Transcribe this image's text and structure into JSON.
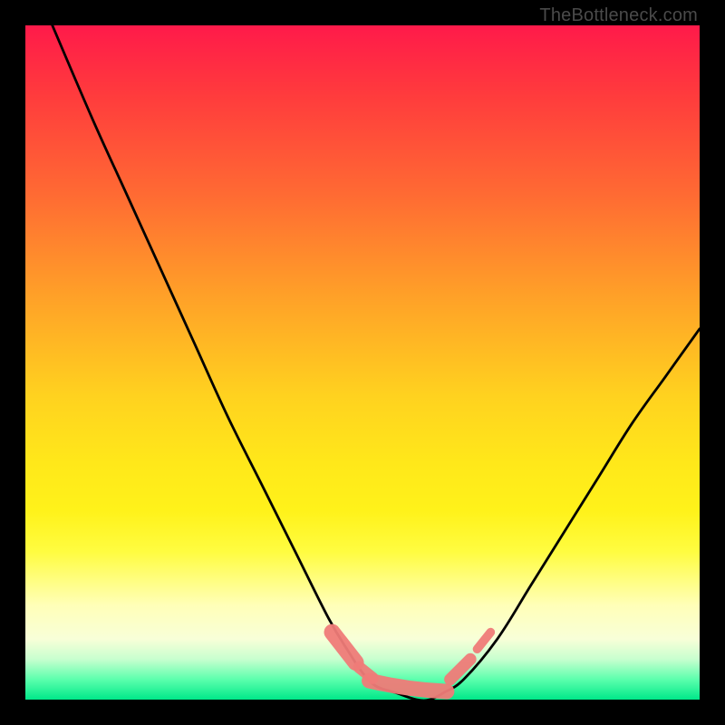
{
  "watermark": "TheBottleneck.com",
  "chart_data": {
    "type": "line",
    "title": "",
    "xlabel": "",
    "ylabel": "",
    "xlim": [
      0,
      100
    ],
    "ylim": [
      0,
      100
    ],
    "series": [
      {
        "name": "curve",
        "x": [
          4,
          10,
          15,
          20,
          25,
          30,
          35,
          40,
          45,
          48,
          50,
          52,
          55,
          58,
          60,
          62,
          65,
          70,
          75,
          80,
          85,
          90,
          95,
          100
        ],
        "y": [
          100,
          86,
          75,
          64,
          53,
          42,
          32,
          22,
          12,
          7,
          4,
          2,
          1,
          0,
          0,
          1,
          3,
          9,
          17,
          25,
          33,
          41,
          48,
          55
        ]
      }
    ],
    "highlight_segments": [
      {
        "x": [
          45.5,
          49.0
        ],
        "y": [
          10.0,
          5.5
        ],
        "width": 3.0
      },
      {
        "x": [
          49.5,
          51.5
        ],
        "y": [
          4.8,
          3.2
        ],
        "width": 2.2
      },
      {
        "x": [
          51.0,
          62.5
        ],
        "y": [
          2.8,
          1.2
        ],
        "width": 2.8
      },
      {
        "x": [
          63.0,
          66.0
        ],
        "y": [
          3.0,
          6.0
        ],
        "width": 2.2
      },
      {
        "x": [
          67.0,
          69.0
        ],
        "y": [
          7.5,
          10.0
        ],
        "width": 1.6
      }
    ],
    "colors": {
      "curve": "#000000",
      "highlight": "#ef7b78",
      "gradient_top": "#ff1a4a",
      "gradient_mid": "#ffe81a",
      "gradient_bottom": "#00e889"
    }
  }
}
